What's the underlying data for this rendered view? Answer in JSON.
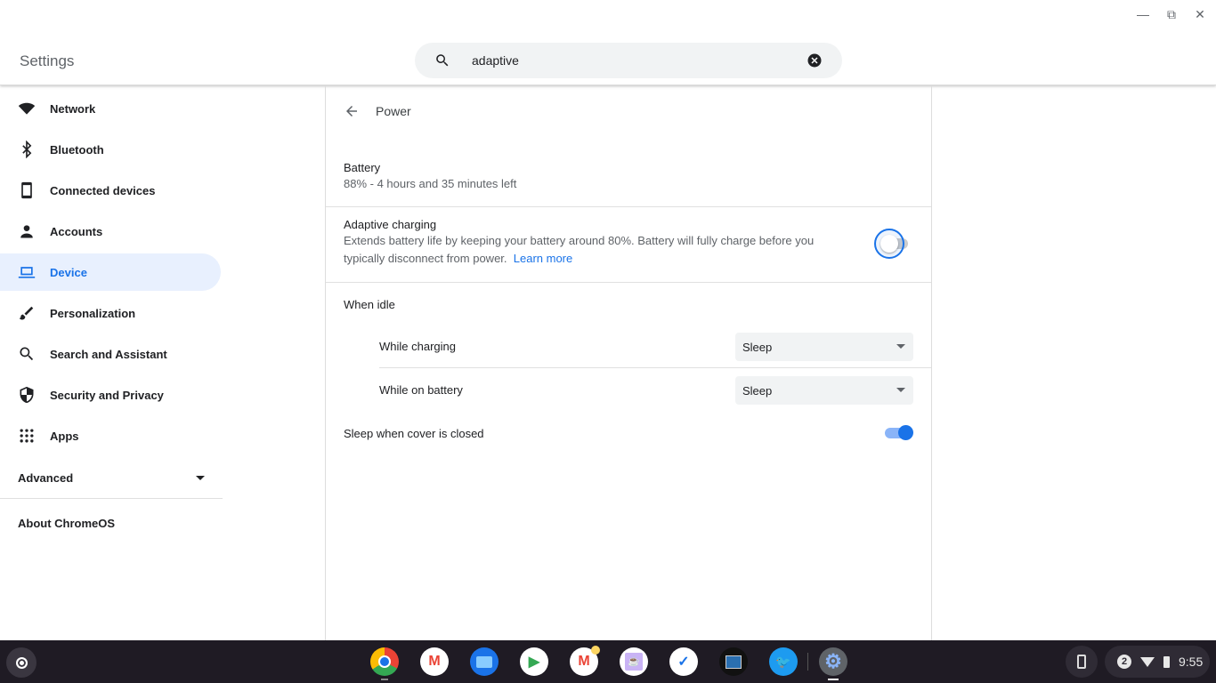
{
  "window": {
    "controls": [
      "minimize",
      "restore",
      "close"
    ]
  },
  "header": {
    "title": "Settings",
    "search_value": "adaptive"
  },
  "sidebar": {
    "items": [
      {
        "label": "Network",
        "icon": "wifi-icon"
      },
      {
        "label": "Bluetooth",
        "icon": "bluetooth-icon"
      },
      {
        "label": "Connected devices",
        "icon": "phone-icon"
      },
      {
        "label": "Accounts",
        "icon": "person-icon"
      },
      {
        "label": "Device",
        "icon": "laptop-icon",
        "selected": true
      },
      {
        "label": "Personalization",
        "icon": "brush-icon"
      },
      {
        "label": "Search and Assistant",
        "icon": "search-icon"
      },
      {
        "label": "Security and Privacy",
        "icon": "shield-icon"
      },
      {
        "label": "Apps",
        "icon": "apps-grid-icon"
      }
    ],
    "advanced": "Advanced",
    "about": "About ChromeOS"
  },
  "main": {
    "title": "Power",
    "battery": {
      "label": "Battery",
      "status": "88% - 4 hours and 35 minutes left"
    },
    "adaptive": {
      "label": "Adaptive charging",
      "description": "Extends battery life by keeping your battery around 80%. Battery will fully charge before you typically disconnect from power.",
      "link": "Learn more",
      "enabled": false
    },
    "idle": {
      "label": "When idle",
      "charging_label": "While charging",
      "charging_value": "Sleep",
      "battery_label": "While on battery",
      "battery_value": "Sleep"
    },
    "cover": {
      "label": "Sleep when cover is closed",
      "enabled": true
    }
  },
  "taskbar": {
    "apps": [
      "Chrome",
      "Gmail",
      "Files",
      "Play Store",
      "Gmail",
      "Cafe",
      "Tasks",
      "Photos",
      "Twitter",
      "Settings"
    ],
    "notifications": "2",
    "time": "9:55",
    "accent": "#1a73e8"
  }
}
